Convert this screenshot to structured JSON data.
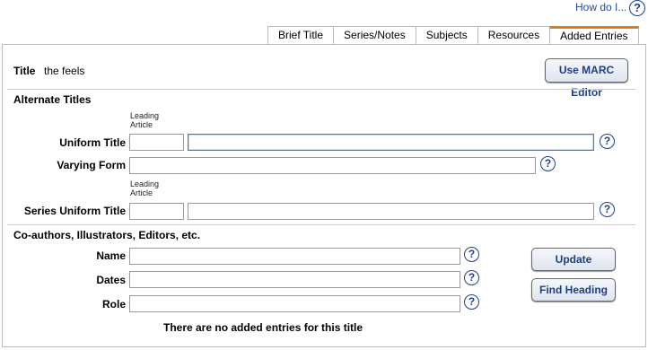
{
  "help": {
    "how_do_i": "How do I..."
  },
  "tabs": [
    {
      "label": "Brief Title"
    },
    {
      "label": "Series/Notes"
    },
    {
      "label": "Subjects"
    },
    {
      "label": "Resources"
    },
    {
      "label": "Added Entries"
    }
  ],
  "title_row": {
    "label": "Title",
    "value": "the feels"
  },
  "marc_button": "Use MARC Editor",
  "alternate": {
    "heading": "Alternate Titles",
    "leading_article": "Leading\nArticle",
    "uniform_title": {
      "label": "Uniform Title",
      "article_value": "",
      "value": ""
    },
    "varying_form": {
      "label": "Varying Form",
      "value": ""
    },
    "series_uniform_title": {
      "label": "Series Uniform Title",
      "article_value": "",
      "value": ""
    }
  },
  "coauthors": {
    "heading": "Co-authors, Illustrators, Editors, etc.",
    "name": {
      "label": "Name",
      "value": ""
    },
    "dates": {
      "label": "Dates",
      "value": ""
    },
    "role": {
      "label": "Role",
      "value": ""
    },
    "update_button": "Update",
    "find_heading_button": "Find Heading",
    "empty_message": "There are no added entries for this title"
  }
}
